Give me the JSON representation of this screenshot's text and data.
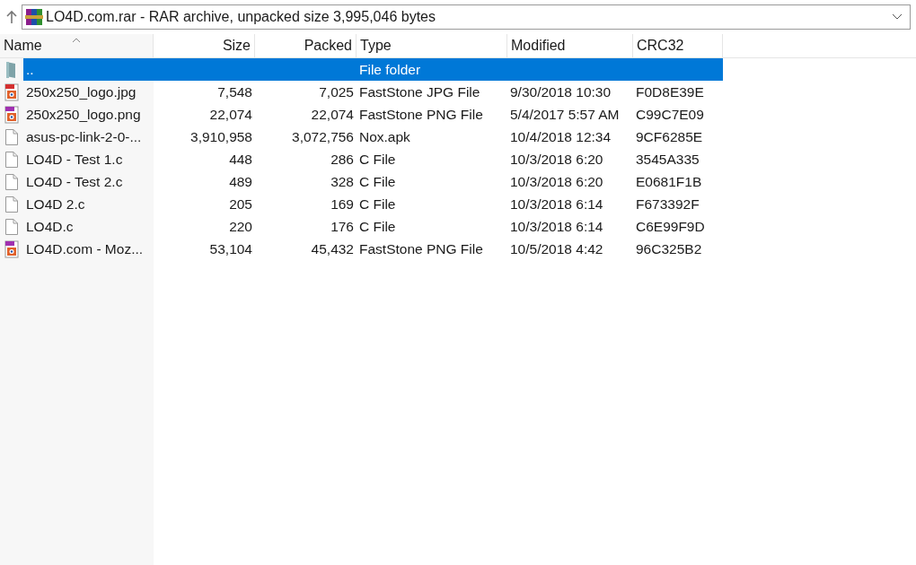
{
  "path_bar": {
    "text": "LO4D.com.rar - RAR archive, unpacked size 3,995,046 bytes"
  },
  "columns": [
    {
      "label": "Name",
      "sorted": true
    },
    {
      "label": "Size",
      "sorted": false
    },
    {
      "label": "Packed",
      "sorted": false
    },
    {
      "label": "Type",
      "sorted": false
    },
    {
      "label": "Modified",
      "sorted": false
    },
    {
      "label": "CRC32",
      "sorted": false
    }
  ],
  "rows": [
    {
      "kind": "folder",
      "selected": true,
      "cells": [
        "..",
        "",
        "",
        "File folder",
        "",
        ""
      ]
    },
    {
      "kind": "jpg",
      "selected": false,
      "cells": [
        "250x250_logo.jpg",
        "7,548",
        "7,025",
        "FastStone JPG File",
        "9/30/2018 10:30",
        "F0D8E39E"
      ]
    },
    {
      "kind": "png",
      "selected": false,
      "cells": [
        "250x250_logo.png",
        "22,074",
        "22,074",
        "FastStone PNG File",
        "5/4/2017 5:57 AM",
        "C99C7E09"
      ]
    },
    {
      "kind": "file",
      "selected": false,
      "cells": [
        "asus-pc-link-2-0-...",
        "3,910,958",
        "3,072,756",
        "Nox.apk",
        "10/4/2018 12:34",
        "9CF6285E"
      ]
    },
    {
      "kind": "file",
      "selected": false,
      "cells": [
        "LO4D - Test 1.c",
        "448",
        "286",
        "C File",
        "10/3/2018 6:20",
        "3545A335"
      ]
    },
    {
      "kind": "file",
      "selected": false,
      "cells": [
        "LO4D - Test 2.c",
        "489",
        "328",
        "C File",
        "10/3/2018 6:20",
        "E0681F1B"
      ]
    },
    {
      "kind": "file",
      "selected": false,
      "cells": [
        "LO4D 2.c",
        "205",
        "169",
        "C File",
        "10/3/2018 6:14",
        "F673392F"
      ]
    },
    {
      "kind": "file",
      "selected": false,
      "cells": [
        "LO4D.c",
        "220",
        "176",
        "C File",
        "10/3/2018 6:14",
        "C6E99F9D"
      ]
    },
    {
      "kind": "png",
      "selected": false,
      "cells": [
        "LO4D.com - Moz...",
        "53,104",
        "45,432",
        "FastStone PNG File",
        "10/5/2018 4:42",
        "96C325B2"
      ]
    }
  ]
}
